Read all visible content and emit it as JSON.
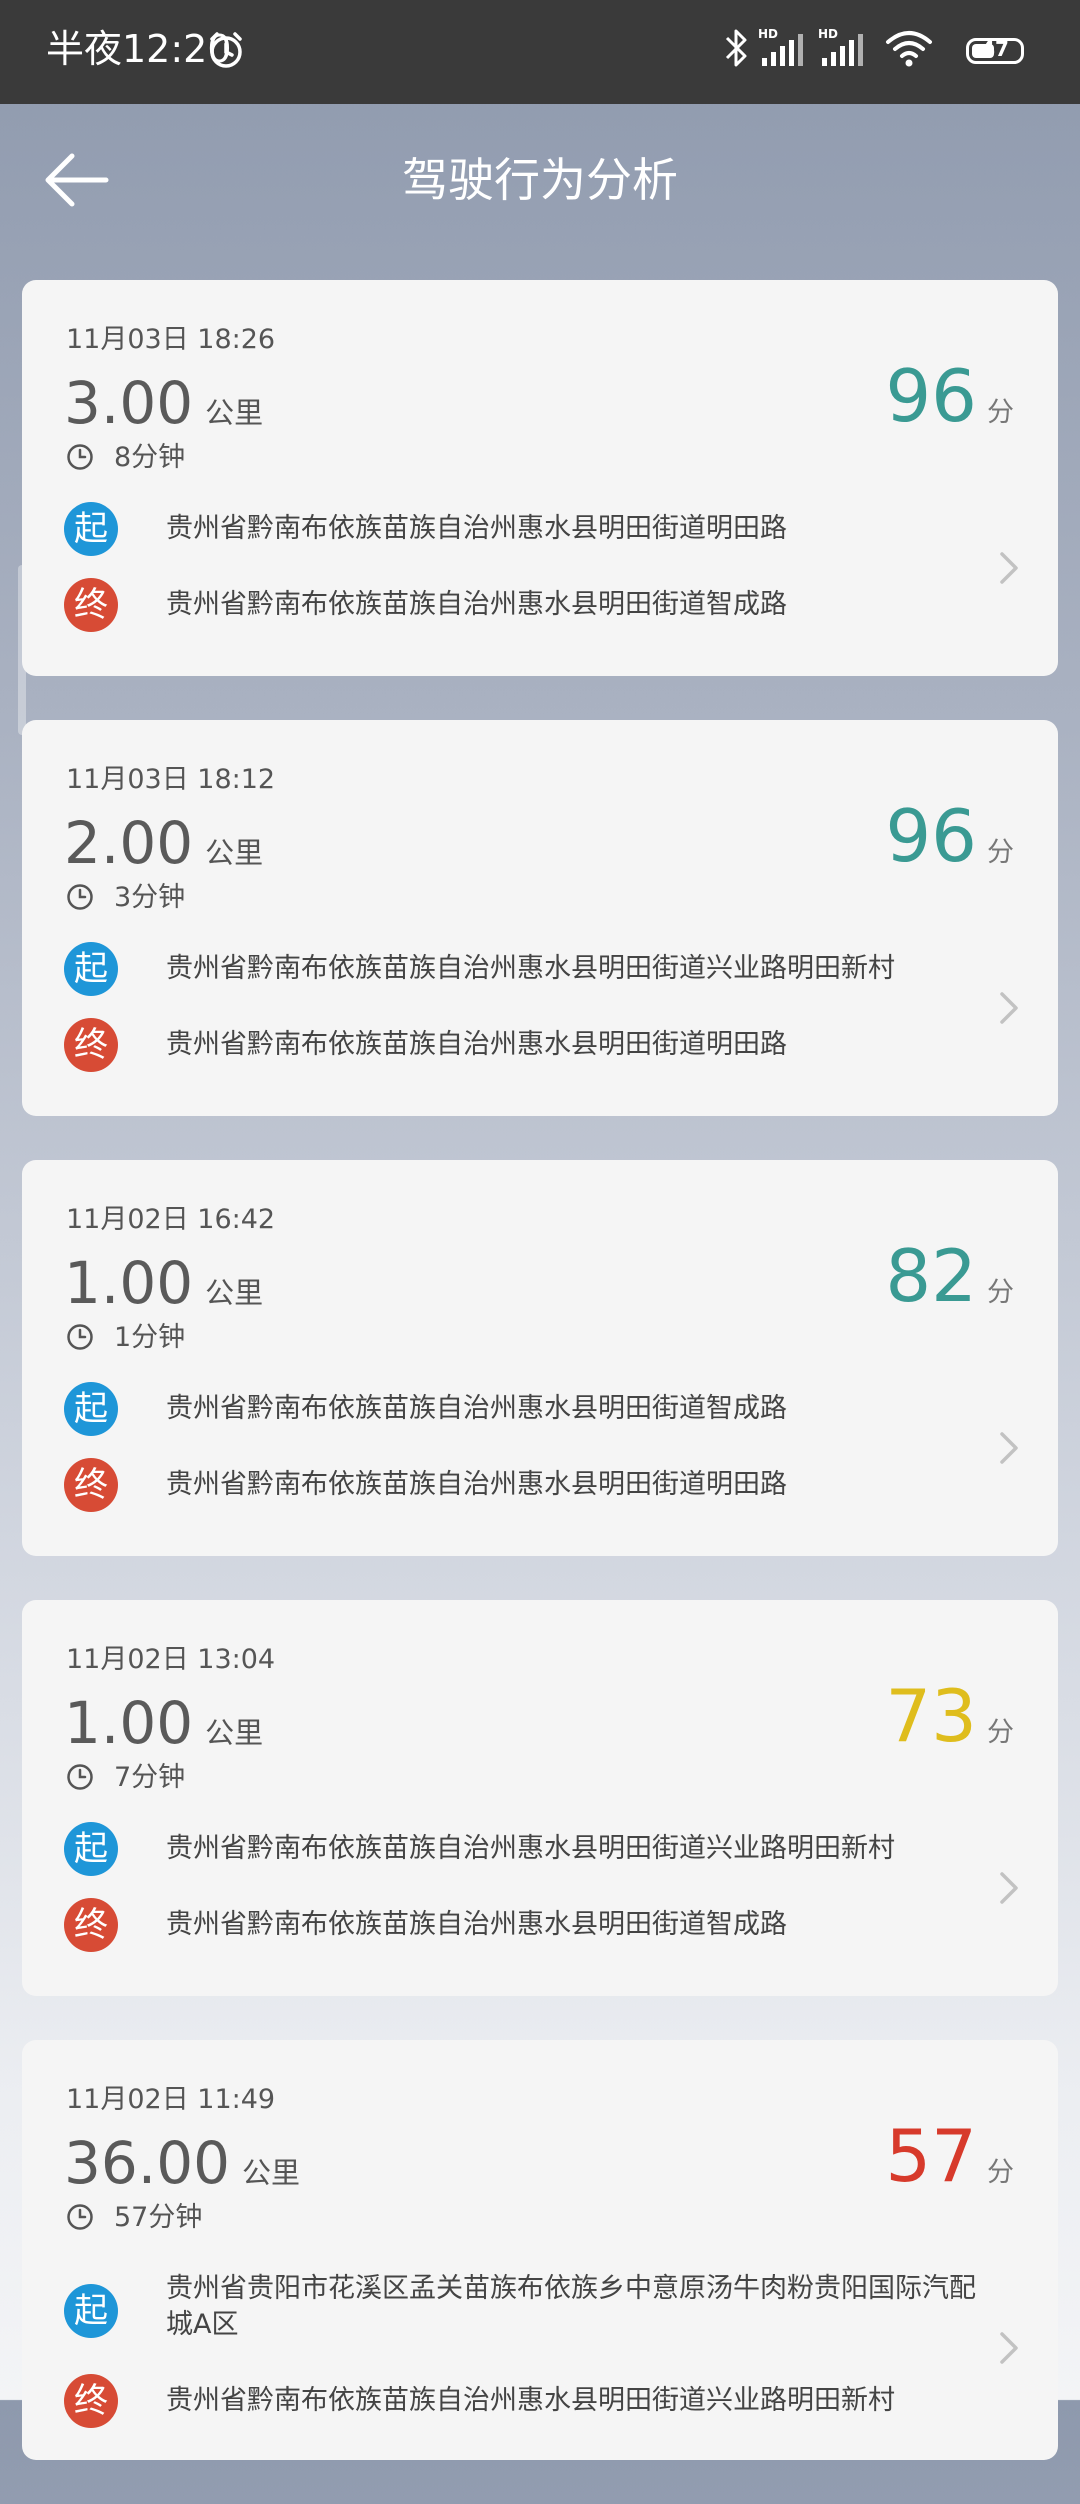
{
  "status_bar": {
    "time": "半夜12:20",
    "battery": "47"
  },
  "header": {
    "title": "驾驶行为分析"
  },
  "colors": {
    "score_high": "#3a9a93",
    "score_mid": "#dfbd1d",
    "score_low": "#d73a2b",
    "start_badge": "#1e96d8",
    "end_badge": "#d74b35"
  },
  "trips": [
    {
      "date": "11月03日 18:26",
      "distance": "3.00",
      "distance_unit": "公里",
      "duration": "8分钟",
      "score": "96",
      "score_unit": "分",
      "start_label": "起",
      "start_address": "贵州省黔南布依族苗族自治州惠水县明田街道明田路",
      "end_label": "终",
      "end_address": "贵州省黔南布依族苗族自治州惠水县明田街道智成路"
    },
    {
      "date": "11月03日 18:12",
      "distance": "2.00",
      "distance_unit": "公里",
      "duration": "3分钟",
      "score": "96",
      "score_unit": "分",
      "start_label": "起",
      "start_address": "贵州省黔南布依族苗族自治州惠水县明田街道兴业路明田新村",
      "end_label": "终",
      "end_address": "贵州省黔南布依族苗族自治州惠水县明田街道明田路"
    },
    {
      "date": "11月02日 16:42",
      "distance": "1.00",
      "distance_unit": "公里",
      "duration": "1分钟",
      "score": "82",
      "score_unit": "分",
      "start_label": "起",
      "start_address": "贵州省黔南布依族苗族自治州惠水县明田街道智成路",
      "end_label": "终",
      "end_address": "贵州省黔南布依族苗族自治州惠水县明田街道明田路"
    },
    {
      "date": "11月02日 13:04",
      "distance": "1.00",
      "distance_unit": "公里",
      "duration": "7分钟",
      "score": "73",
      "score_unit": "分",
      "start_label": "起",
      "start_address": "贵州省黔南布依族苗族自治州惠水县明田街道兴业路明田新村",
      "end_label": "终",
      "end_address": "贵州省黔南布依族苗族自治州惠水县明田街道智成路"
    },
    {
      "date": "11月02日 11:49",
      "distance": "36.00",
      "distance_unit": "公里",
      "duration": "57分钟",
      "score": "57",
      "score_unit": "分",
      "start_label": "起",
      "start_address": "贵州省贵阳市花溪区孟关苗族布依族乡中意原汤牛肉粉贵阳国际汽配城A区",
      "end_label": "终",
      "end_address": "贵州省黔南布依族苗族自治州惠水县明田街道兴业路明田新村"
    }
  ]
}
